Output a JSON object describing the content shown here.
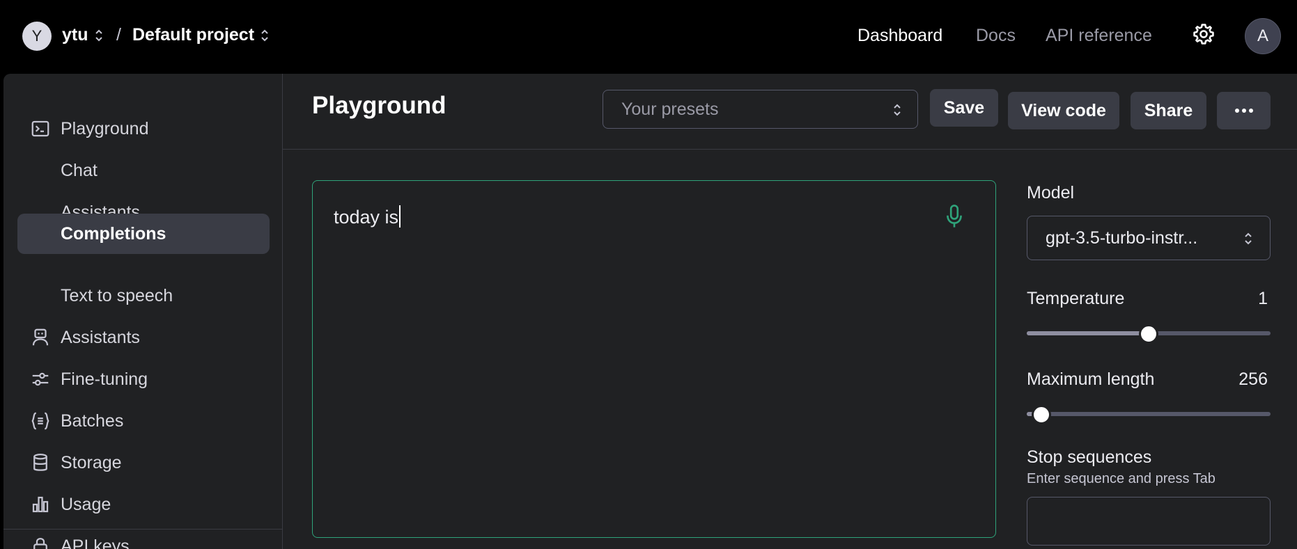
{
  "topbar": {
    "org_avatar_letter": "Y",
    "org_name": "ytu",
    "separator": "/",
    "project_name": "Default project",
    "nav": [
      "Dashboard",
      "Docs",
      "API reference"
    ],
    "user_avatar_letter": "A"
  },
  "sidebar": {
    "items": [
      {
        "label": "Playground",
        "icon": "terminal-icon"
      },
      {
        "label": "Chat",
        "icon": ""
      },
      {
        "label": "Assistants",
        "icon": ""
      },
      {
        "label": "Completions",
        "icon": "",
        "active": true
      },
      {
        "label": "Text to speech",
        "icon": ""
      },
      {
        "label": "Assistants",
        "icon": "robot-icon"
      },
      {
        "label": "Fine-tuning",
        "icon": "sliders-icon"
      },
      {
        "label": "Batches",
        "icon": "braces-list-icon"
      },
      {
        "label": "Storage",
        "icon": "database-icon"
      },
      {
        "label": "Usage",
        "icon": "bar-chart-icon"
      },
      {
        "label": "API keys",
        "icon": "lock-icon"
      }
    ]
  },
  "main": {
    "title": "Playground",
    "presets_placeholder": "Your presets",
    "buttons": {
      "save": "Save",
      "view_code": "View code",
      "share": "Share",
      "more": "•••"
    },
    "editor_text": "today is"
  },
  "settings": {
    "model_label": "Model",
    "model_value": "gpt-3.5-turbo-instr...",
    "temperature_label": "Temperature",
    "temperature_value": "1",
    "temperature_fraction": 0.5,
    "max_length_label": "Maximum length",
    "max_length_value": "256",
    "max_length_fraction": 0.06,
    "stop_label": "Stop sequences",
    "stop_hint": "Enter sequence and press Tab"
  },
  "colors": {
    "accent": "#2fa37a",
    "background": "#202123",
    "topbar": "#000000"
  }
}
